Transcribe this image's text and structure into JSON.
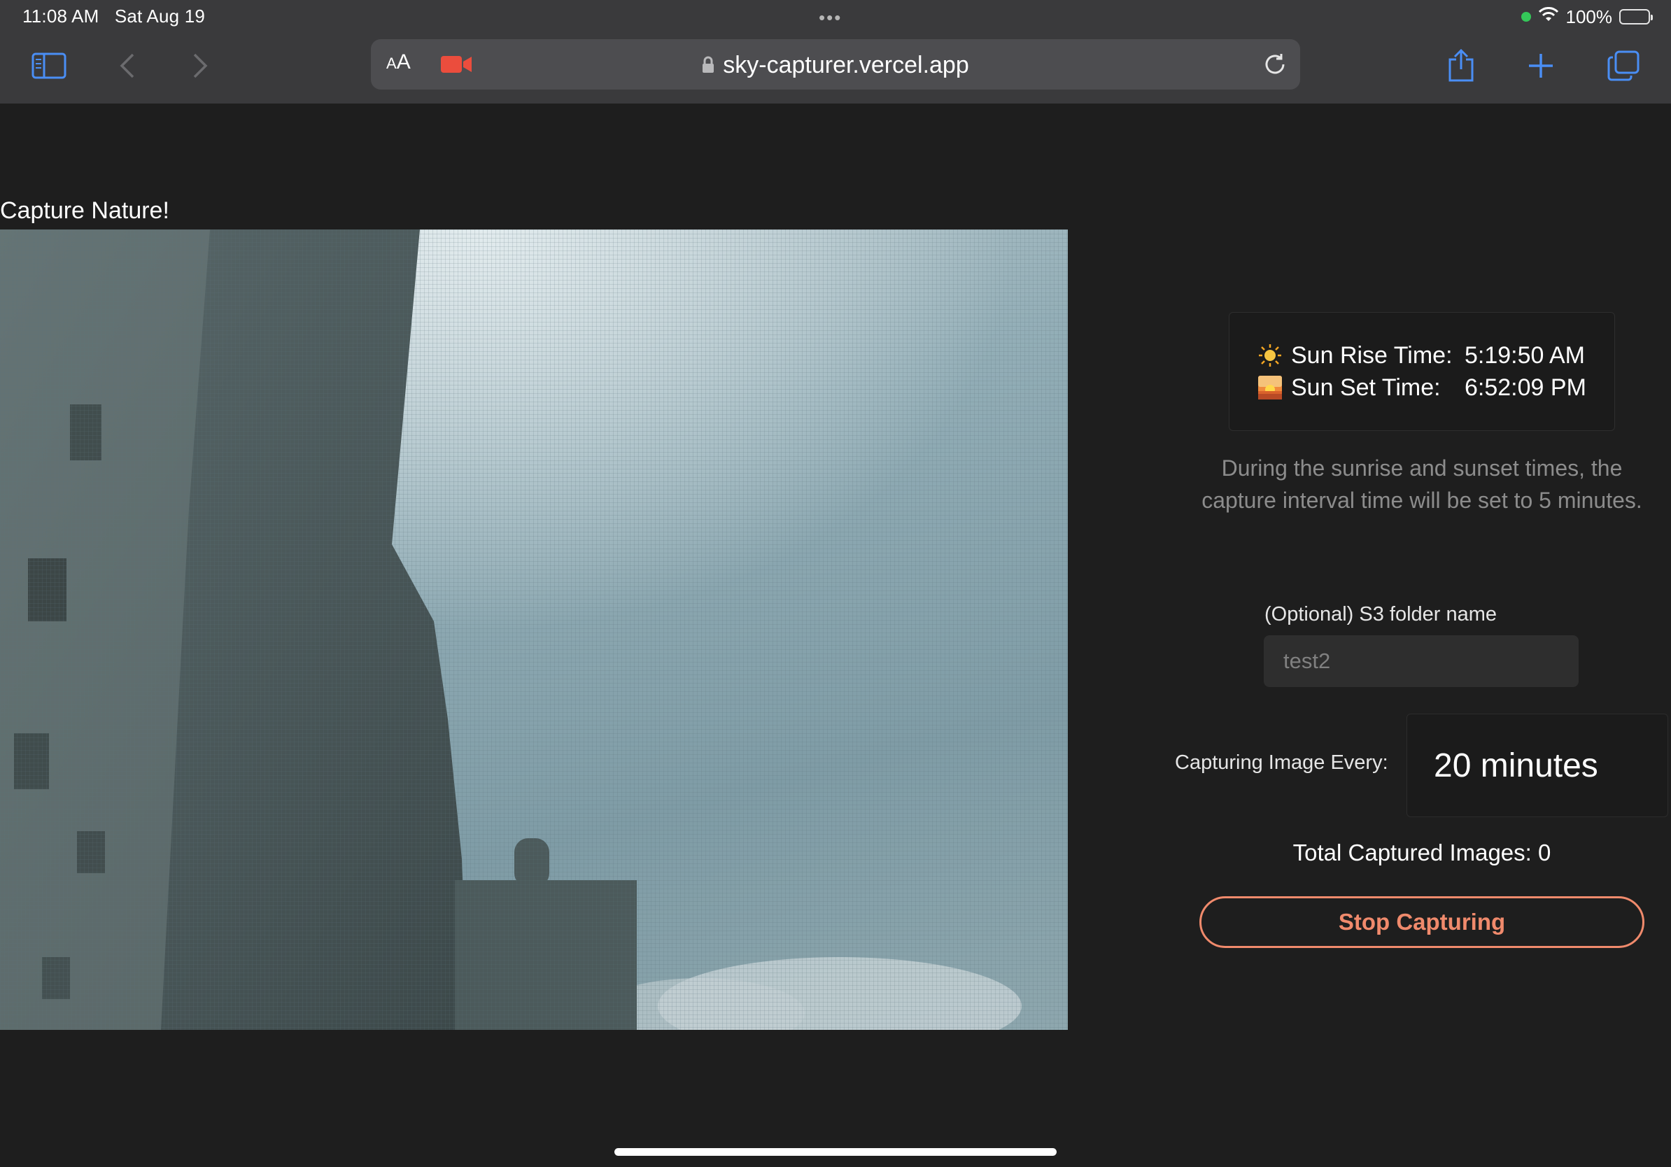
{
  "status_bar": {
    "time": "11:08 AM",
    "date": "Sat Aug 19",
    "battery": "100%"
  },
  "browser": {
    "reader_label_small": "A",
    "reader_label_large": "A",
    "url": "sky-capturer.vercel.app"
  },
  "page": {
    "title": "Capture Nature!",
    "sun": {
      "rise_label": "Sun Rise Time:",
      "rise_value": "5:19:50 AM",
      "set_label": "Sun Set Time:",
      "set_value": "6:52:09 PM"
    },
    "note": "During the sunrise and sunset times, the capture interval time will be set to 5 minutes.",
    "folder": {
      "label": "(Optional) S3 folder name",
      "placeholder": "test2"
    },
    "interval": {
      "label": "Capturing Image Every:",
      "value": "20 minutes"
    },
    "total_captured": "Total Captured Images: 0",
    "stop_button": "Stop Capturing"
  },
  "colors": {
    "background": "#1e1e1e",
    "browser_chrome": "#3a3a3c",
    "accent": "#f08a6c",
    "battery_green": "#34c759"
  }
}
